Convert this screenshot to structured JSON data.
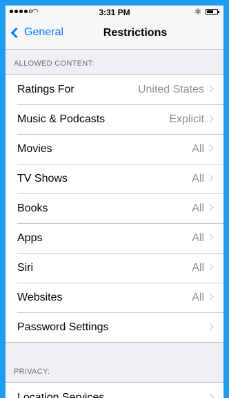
{
  "status_bar": {
    "time": "3:31 PM",
    "wifi_icon": "wifi-icon",
    "bluetooth_icon": "bluetooth-icon",
    "battery_icon": "battery-icon"
  },
  "nav": {
    "back_label": "General",
    "title": "Restrictions"
  },
  "sections": {
    "allowed": {
      "header": "ALLOWED CONTENT:",
      "rows": [
        {
          "label": "Ratings For",
          "value": "United States"
        },
        {
          "label": "Music & Podcasts",
          "value": "Explicit"
        },
        {
          "label": "Movies",
          "value": "All"
        },
        {
          "label": "TV Shows",
          "value": "All"
        },
        {
          "label": "Books",
          "value": "All"
        },
        {
          "label": "Apps",
          "value": "All"
        },
        {
          "label": "Siri",
          "value": "All"
        },
        {
          "label": "Websites",
          "value": "All"
        },
        {
          "label": "Password Settings",
          "value": ""
        }
      ]
    },
    "privacy": {
      "header": "PRIVACY:",
      "rows": [
        {
          "label": "Location Services",
          "value": ""
        }
      ]
    }
  },
  "colors": {
    "frame_blue": "#1e9cf0",
    "ios_blue": "#007aff",
    "background": "#efeff4"
  }
}
